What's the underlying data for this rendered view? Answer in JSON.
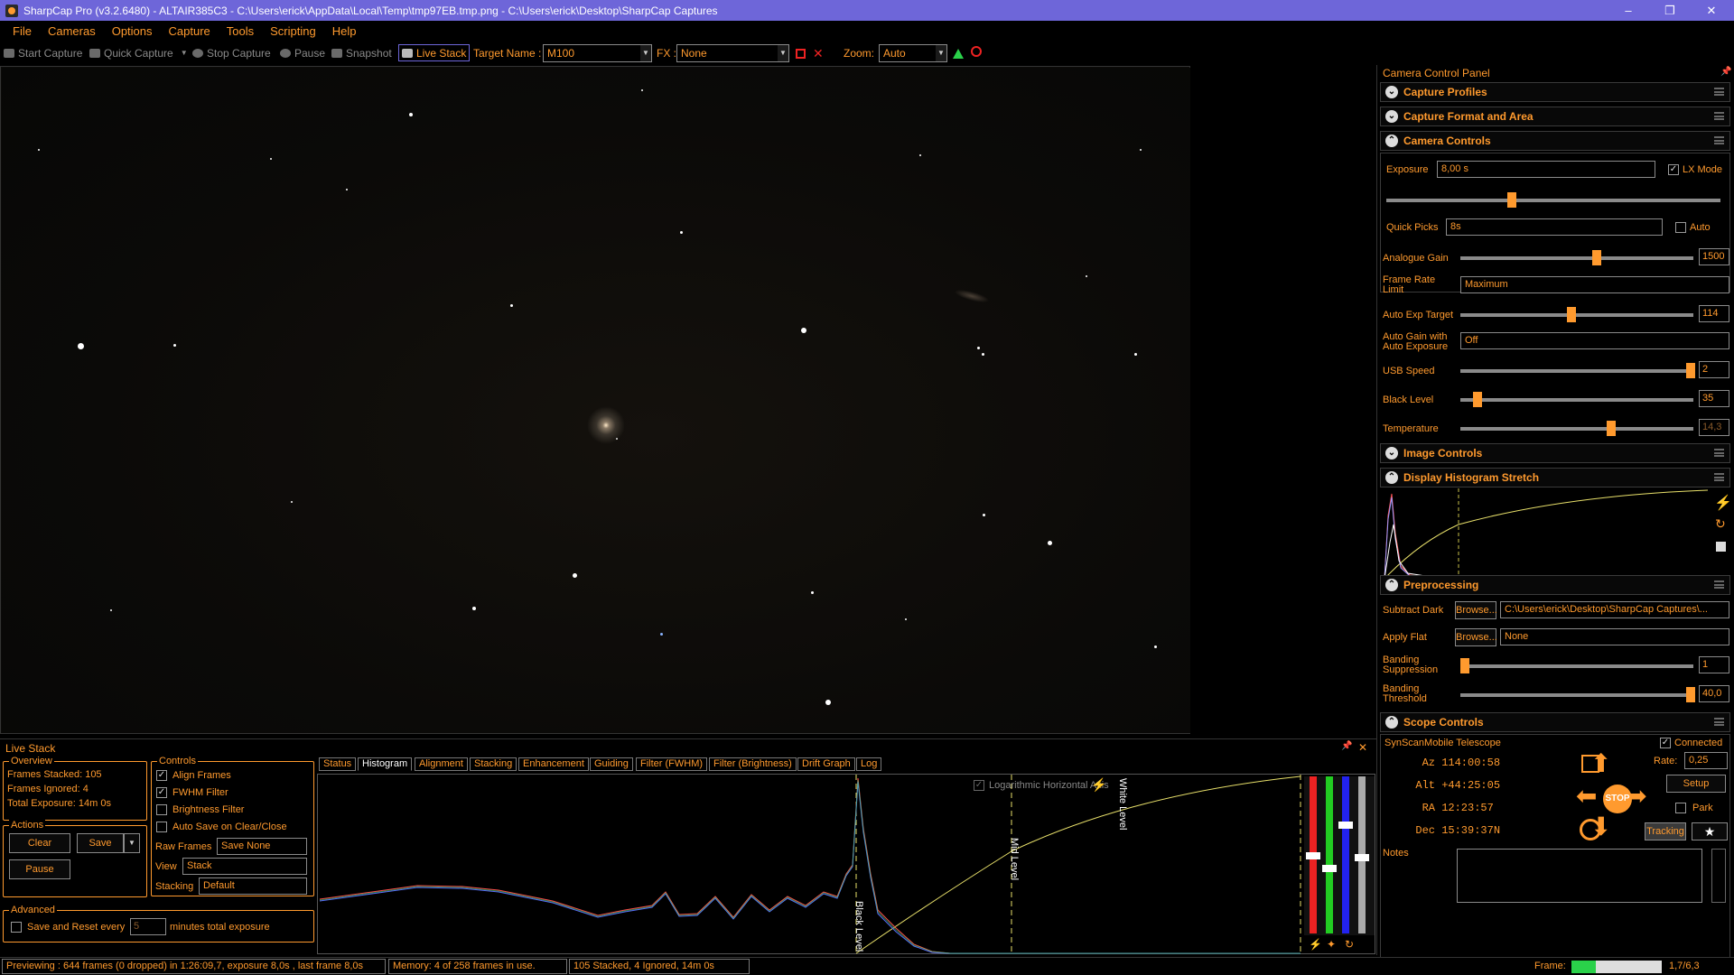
{
  "window": {
    "title": "SharpCap Pro (v3.2.6480) - ALTAIR385C3 - C:\\Users\\erick\\AppData\\Local\\Temp\\tmp97EB.tmp.png - C:\\Users\\erick\\Desktop\\SharpCap Captures",
    "minimize": "–",
    "restore": "❐",
    "close": "✕"
  },
  "menu": [
    "File",
    "Cameras",
    "Options",
    "Capture",
    "Tools",
    "Scripting",
    "Help"
  ],
  "toolbar": {
    "start_capture": "Start Capture",
    "quick_capture": "Quick Capture",
    "stop_capture": "Stop Capture",
    "pause": "Pause",
    "snapshot": "Snapshot",
    "live_stack": "Live Stack",
    "target_name_label": "Target Name :",
    "target_name_value": "M100",
    "fx_label": "FX :",
    "fx_value": "None",
    "zoom_label": "Zoom:",
    "zoom_value": "Auto"
  },
  "panel": {
    "title": "Camera Control Panel",
    "pin": "📌",
    "sections": {
      "capture_profiles": "Capture Profiles",
      "capture_format": "Capture Format and Area",
      "camera_controls": "Camera Controls",
      "image_controls": "Image Controls",
      "display_histogram": "Display Histogram Stretch",
      "preprocessing": "Preprocessing",
      "scope_controls": "Scope Controls"
    },
    "camera": {
      "exposure_label": "Exposure",
      "exposure_value": "8,00 s",
      "lx_mode_label": "LX Mode",
      "quick_picks_label": "Quick Picks",
      "quick_picks_value": "8s",
      "auto_label": "Auto",
      "analogue_gain_label": "Analogue Gain",
      "analogue_gain_value": "1500",
      "frame_rate_label_1": "Frame Rate",
      "frame_rate_label_2": "Limit",
      "frame_rate_value": "Maximum",
      "auto_exp_label": "Auto Exp Target",
      "auto_exp_value": "114",
      "auto_gain_label_1": "Auto Gain with",
      "auto_gain_label_2": "Auto Exposure",
      "auto_gain_value": "Off",
      "usb_speed_label": "USB Speed",
      "usb_speed_value": "2",
      "black_level_label": "Black Level",
      "black_level_value": "35",
      "temperature_label": "Temperature",
      "temperature_value": "14,3"
    },
    "preprocessing": {
      "subtract_dark_label": "Subtract Dark",
      "browse": "Browse...",
      "dark_path": "C:\\Users\\erick\\Desktop\\SharpCap Captures\\...",
      "apply_flat_label": "Apply Flat",
      "flat_value": "None",
      "banding_supp_label_1": "Banding",
      "banding_supp_label_2": "Suppression",
      "banding_supp_value": "1",
      "banding_thresh_label_1": "Banding",
      "banding_thresh_label_2": "Threshold",
      "banding_thresh_value": "40,0"
    },
    "scope": {
      "telescope": "SynScanMobile Telescope",
      "connected": "Connected",
      "az_label": "Az",
      "az_value": "114:00:58",
      "alt_label": "Alt",
      "alt_value": "+44:25:05",
      "ra_label": "RA",
      "ra_value": "12:23:57",
      "dec_label": "Dec",
      "dec_value": "15:39:37N",
      "rate_label": "Rate:",
      "rate_value": "0,25",
      "setup": "Setup",
      "park": "Park",
      "stop": "STOP",
      "tracking": "Tracking",
      "notes_label": "Notes"
    }
  },
  "livestack": {
    "title": "Live Stack",
    "overview_title": "Overview",
    "frames_stacked": "Frames Stacked:  105",
    "frames_ignored": "Frames Ignored:  4",
    "total_exposure": "Total Exposure:   14m 0s",
    "actions_title": "Actions",
    "clear": "Clear",
    "save": "Save",
    "pause": "Pause",
    "advanced_title": "Advanced",
    "save_reset_label": "Save and Reset every",
    "save_reset_value": "5",
    "minutes_label": "minutes total exposure",
    "controls_title": "Controls",
    "align_frames": "Align Frames",
    "fwhm_filter": "FWHM Filter",
    "brightness_filter": "Brightness Filter",
    "auto_save": "Auto Save on Clear/Close",
    "raw_frames_label": "Raw Frames",
    "raw_frames_value": "Save None",
    "view_label": "View",
    "view_value": "Stack",
    "stacking_label": "Stacking",
    "stacking_value": "Default",
    "tabs": [
      "Status",
      "Histogram",
      "Alignment",
      "Stacking",
      "Enhancement",
      "Guiding",
      "Filter (FWHM)",
      "Filter (Brightness)",
      "Drift Graph",
      "Log"
    ],
    "log_axis_label": "Logarithmic Horizontal Axis",
    "black_level": "Black Level",
    "mid_level": "Mid Level",
    "white_level": "White Level"
  },
  "status": {
    "previewing": "Previewing : 644 frames (0 dropped) in 1:26:09,7, exposure 8,0s , last frame 8,0s",
    "memory": "Memory: 4 of 258 frames in use.",
    "stacked": "105 Stacked, 4 Ignored, 14m 0s",
    "frame_label": "Frame:",
    "frame_value": "1,7/6,3",
    "frame_progress": 0.27
  },
  "colors": {
    "accent": "#ff9a2e",
    "titlebar": "#6e66d9",
    "histogram_curve": "#e8e06a"
  }
}
